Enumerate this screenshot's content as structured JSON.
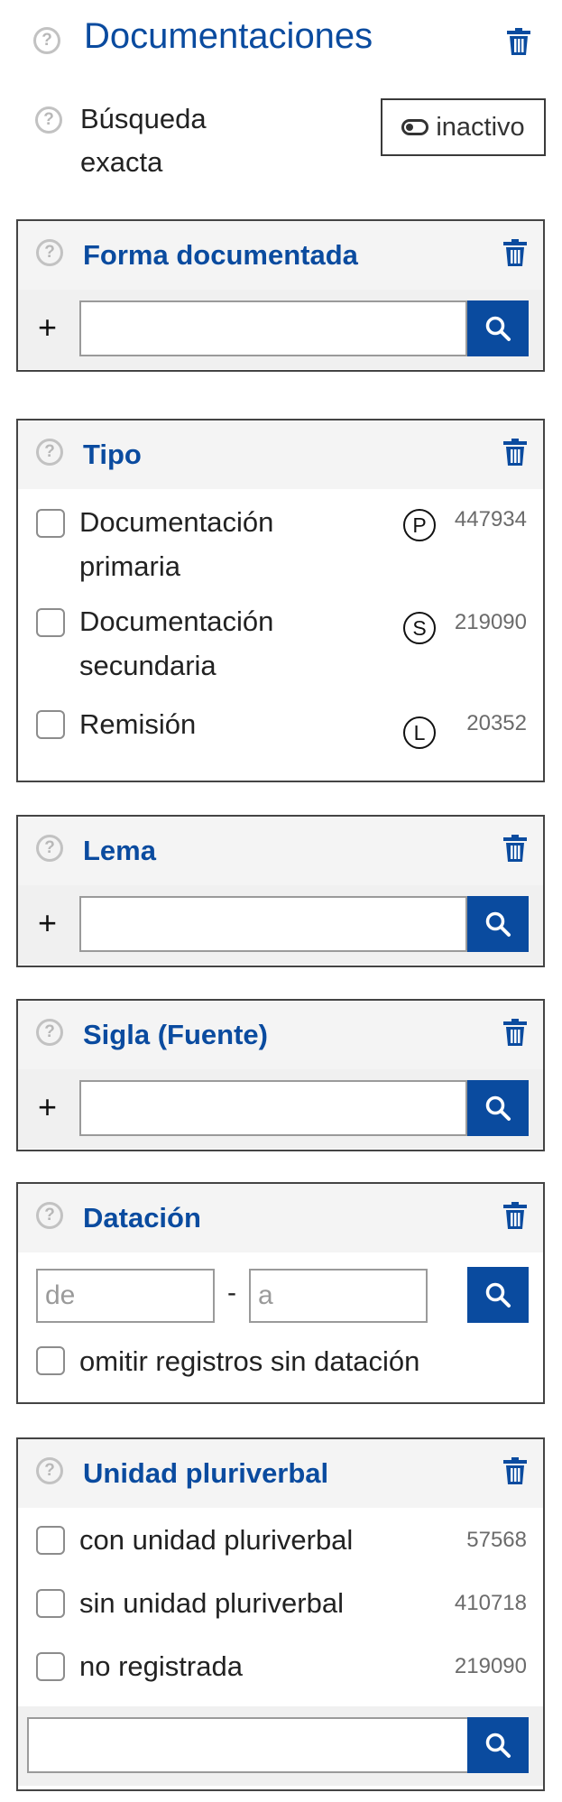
{
  "header": {
    "title": "Documentaciones",
    "help_glyph": "?",
    "exact_search_label": "Búsqueda exacta",
    "toggle_label": "inactivo"
  },
  "forma": {
    "title": "Forma documentada",
    "plus": "+",
    "input_value": ""
  },
  "tipo": {
    "title": "Tipo",
    "items": [
      {
        "label": "Documentación primaria",
        "badge": "P",
        "count": "447934"
      },
      {
        "label": "Documentación secundaria",
        "badge": "S",
        "count": "219090"
      },
      {
        "label": "Remisión",
        "badge": "L",
        "count": "20352"
      }
    ]
  },
  "lema": {
    "title": "Lema",
    "plus": "+",
    "input_value": ""
  },
  "sigla": {
    "title": "Sigla (Fuente)",
    "plus": "+",
    "input_value": ""
  },
  "datacion": {
    "title": "Datación",
    "from_placeholder": "de",
    "separator": "-",
    "to_placeholder": "a",
    "omit_label": "omitir registros sin datación"
  },
  "unidad": {
    "title": "Unidad pluriverbal",
    "items": [
      {
        "label": "con unidad pluriverbal",
        "count": "57568"
      },
      {
        "label": "sin unidad pluriverbal",
        "count": "410718"
      },
      {
        "label": "no registrada",
        "count": "219090"
      }
    ],
    "input_value": ""
  },
  "colors": {
    "accent": "#0a4b9f",
    "panel_header_bg": "#f4f4f4",
    "help_gray": "#c2c2c2"
  },
  "icons": {
    "help": "help-circle-icon",
    "trash": "trash-icon",
    "search": "magnifier-icon",
    "toggle": "toggle-off-icon"
  }
}
